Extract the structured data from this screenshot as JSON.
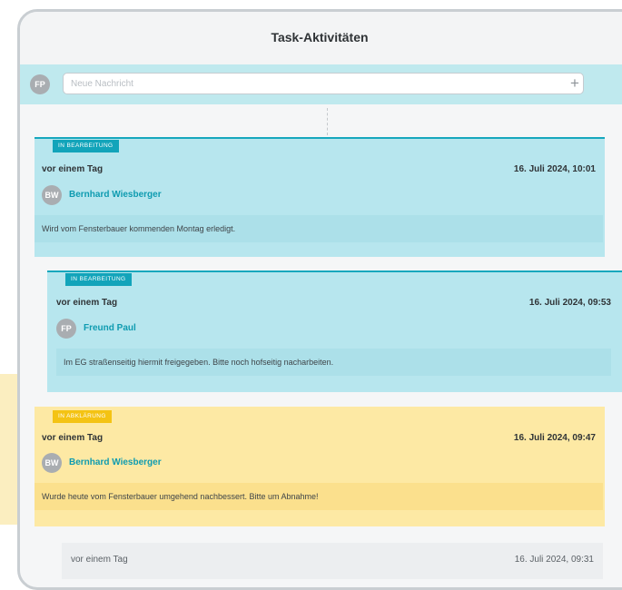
{
  "header": {
    "title": "Task-Aktivitäten"
  },
  "composer": {
    "avatar_initials": "FP",
    "placeholder": "Neue Nachricht",
    "add_icon": "plus-icon"
  },
  "activities": [
    {
      "status": "IN BEARBEITUNG",
      "relative_time": "vor einem Tag",
      "date": "16. Juli 2024, 10:01",
      "author_initials": "BW",
      "author": "Bernhard Wiesberger",
      "message": "Wird vom Fensterbauer kommenden Montag erledigt."
    },
    {
      "status": "IN BEARBEITUNG",
      "relative_time": "vor einem Tag",
      "date": "16. Juli 2024, 09:53",
      "author_initials": "FP",
      "author": "Freund Paul",
      "message": "Im EG straßenseitig hiermit freigegeben. Bitte noch hofseitig nacharbeiten."
    },
    {
      "status": "IN ABKLÄRUNG",
      "relative_time": "vor einem Tag",
      "date": "16. Juli 2024, 09:47",
      "author_initials": "BW",
      "author": "Bernhard Wiesberger",
      "message": "Wurde heute vom Fensterbauer umgehend nachbessert. Bitte um Abnahme!"
    },
    {
      "relative_time": "vor einem Tag",
      "date": "16. Juli 2024, 09:31"
    }
  ],
  "colors": {
    "status_in_progress": "#12a4ba",
    "status_clarification": "#f4c313",
    "author_link": "#0e9bb0"
  }
}
